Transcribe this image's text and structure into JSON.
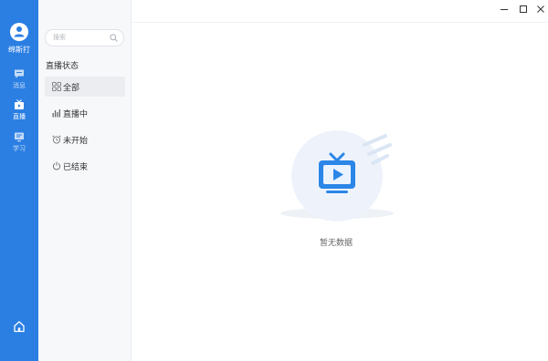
{
  "user": {
    "name": "绵斯打"
  },
  "nav": {
    "items": [
      {
        "label": "消息",
        "icon": "chat-icon"
      },
      {
        "label": "直播",
        "icon": "live-tv-icon",
        "active": true
      },
      {
        "label": "学习",
        "icon": "study-icon"
      }
    ],
    "home_icon": "home-icon"
  },
  "sidebar": {
    "search": {
      "placeholder": "搜索",
      "value": ""
    },
    "section_title": "直播状态",
    "filters": [
      {
        "label": "全部",
        "icon": "grid-icon",
        "selected": true
      },
      {
        "label": "直播中",
        "icon": "bars-icon"
      },
      {
        "label": "未开始",
        "icon": "alarm-clock-icon"
      },
      {
        "label": "已结束",
        "icon": "power-icon"
      }
    ]
  },
  "window": {
    "controls": [
      "minimize-icon",
      "maximize-icon",
      "close-icon"
    ]
  },
  "main": {
    "empty_text": "暂无数据"
  },
  "colors": {
    "accent": "#2b7fe3",
    "panel_bg": "#f7f8fa",
    "selected_bg": "#ebedf0"
  }
}
